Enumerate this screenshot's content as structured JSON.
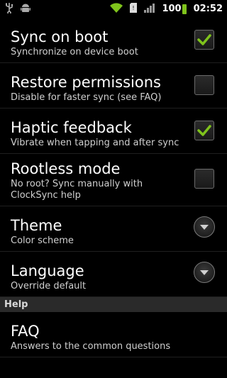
{
  "status_bar": {
    "time": "02:52",
    "battery_percent": "100",
    "icons": [
      "usb-icon",
      "android-debug-icon",
      "wifi-icon",
      "sd-card-icon",
      "signal-icon",
      "battery-icon"
    ],
    "battery_color": "#7fc31c",
    "wifi_color": "#7fc31c"
  },
  "preferences": [
    {
      "title": "Sync on boot",
      "summary": "Synchronize on device boot",
      "widget": "checkbox",
      "checked": true
    },
    {
      "title": "Restore permissions",
      "summary": "Disable for faster sync (see FAQ)",
      "widget": "checkbox",
      "checked": false
    },
    {
      "title": "Haptic feedback",
      "summary": "Vibrate when tapping and after sync",
      "widget": "checkbox",
      "checked": true
    },
    {
      "title": "Rootless mode",
      "summary": "No root? Sync manually with ClockSync help",
      "widget": "checkbox",
      "checked": false
    },
    {
      "title": "Theme",
      "summary": "Color scheme",
      "widget": "dropdown"
    },
    {
      "title": "Language",
      "summary": "Override default",
      "widget": "dropdown"
    }
  ],
  "section_help": {
    "label": "Help"
  },
  "help_items": [
    {
      "title": "FAQ",
      "summary": "Answers to the common questions"
    }
  ],
  "colors": {
    "check_green": "#7fc31c",
    "background": "#000000",
    "section_header": "#2a2a2a"
  }
}
